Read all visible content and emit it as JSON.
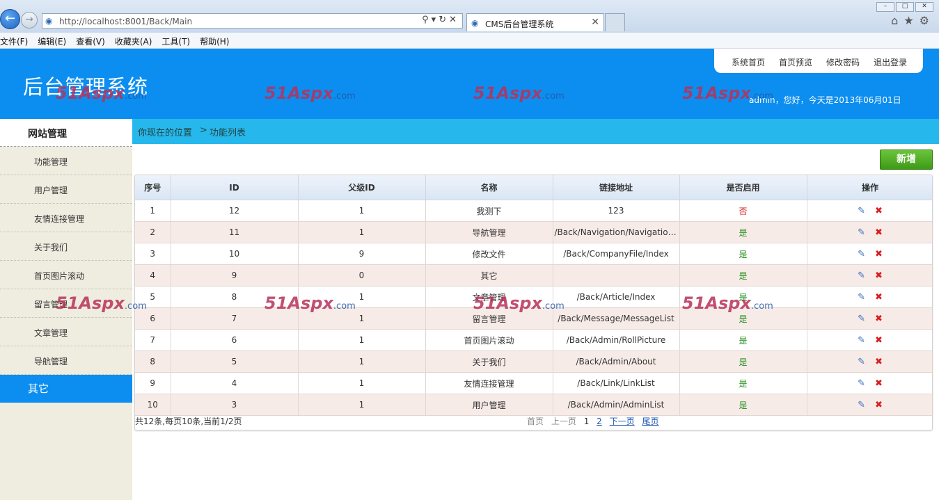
{
  "browser": {
    "url": "http://localhost:8001/Back/Main",
    "tab_title": "CMS后台管理系统",
    "menu": [
      "文件(F)",
      "编辑(E)",
      "查看(V)",
      "收藏夹(A)",
      "工具(T)",
      "帮助(H)"
    ]
  },
  "header": {
    "title": "后台管理系统",
    "links": [
      "系统首页",
      "首页预览",
      "修改密码",
      "退出登录"
    ],
    "welcome": "admin，您好，今天是2013年06月01日",
    "watermark": "51Aspx",
    "watermark_suffix": ".com"
  },
  "sidebar": {
    "heading": "网站管理",
    "items": [
      "功能管理",
      "用户管理",
      "友情连接管理",
      "关于我们",
      "首页图片滚动",
      "留言管理",
      "文章管理",
      "导航管理"
    ],
    "other": "其它"
  },
  "breadcrumb": {
    "prefix": "你现在的位置",
    "separator": ">",
    "current": "功能列表"
  },
  "toolbar": {
    "add_label": "新增"
  },
  "table": {
    "columns": [
      "序号",
      "ID",
      "父级ID",
      "名称",
      "链接地址",
      "是否启用",
      "操作"
    ],
    "rows": [
      {
        "no": "1",
        "id": "12",
        "parent": "1",
        "name": "我测下",
        "link": "123",
        "enabled": "否"
      },
      {
        "no": "2",
        "id": "11",
        "parent": "1",
        "name": "导航管理",
        "link": "/Back/Navigation/NavigationList",
        "enabled": "是"
      },
      {
        "no": "3",
        "id": "10",
        "parent": "9",
        "name": "修改文件",
        "link": "/Back/CompanyFile/Index",
        "enabled": "是"
      },
      {
        "no": "4",
        "id": "9",
        "parent": "0",
        "name": "其它",
        "link": "",
        "enabled": "是"
      },
      {
        "no": "5",
        "id": "8",
        "parent": "1",
        "name": "文章管理",
        "link": "/Back/Article/Index",
        "enabled": "是"
      },
      {
        "no": "6",
        "id": "7",
        "parent": "1",
        "name": "留言管理",
        "link": "/Back/Message/MessageList",
        "enabled": "是"
      },
      {
        "no": "7",
        "id": "6",
        "parent": "1",
        "name": "首页图片滚动",
        "link": "/Back/Admin/RollPicture",
        "enabled": "是"
      },
      {
        "no": "8",
        "id": "5",
        "parent": "1",
        "name": "关于我们",
        "link": "/Back/Admin/About",
        "enabled": "是"
      },
      {
        "no": "9",
        "id": "4",
        "parent": "1",
        "name": "友情连接管理",
        "link": "/Back/Link/LinkList",
        "enabled": "是"
      },
      {
        "no": "10",
        "id": "3",
        "parent": "1",
        "name": "用户管理",
        "link": "/Back/Admin/AdminList",
        "enabled": "是"
      }
    ]
  },
  "pagination": {
    "summary": "共12条,每页10条,当前1/2页",
    "first": "首页",
    "prev": "上一页",
    "pages": [
      "1",
      "2"
    ],
    "next": "下一页",
    "last": "尾页"
  },
  "colors": {
    "header_blue": "#0b8ef0",
    "breadcrumb_blue": "#26b8ec",
    "add_green": "#4fae23"
  }
}
